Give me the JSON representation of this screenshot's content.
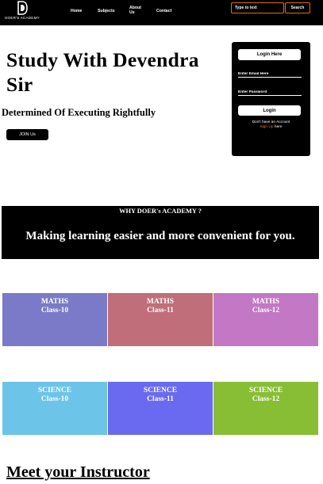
{
  "brand": {
    "logo_text": "DOER'S ACADEMY",
    "accent_color": "#e86a14"
  },
  "nav": {
    "items": [
      {
        "label": "Home"
      },
      {
        "label": "Subjects"
      },
      {
        "label": "About Us"
      },
      {
        "label": "Contact"
      }
    ],
    "search": {
      "placeholder": "Type to text",
      "button_label": "Search"
    }
  },
  "hero": {
    "title": "Study With Devendra Sir",
    "subtitle": "Determined Of Executing Rightfully",
    "cta_label": "JOIN Us"
  },
  "login": {
    "heading": "Login Here",
    "email_placeholder": "Enter Email Here",
    "password_placeholder": "Enter Password",
    "submit_label": "Login",
    "no_account_text": "Don't have an Account",
    "signup_label": "Sign Up",
    "signup_suffix": "here"
  },
  "why": {
    "label": "WHY DOER's ACADEMY ?",
    "text": "Making learning easier and more convenient for you."
  },
  "courses": [
    {
      "subject": "MATHS",
      "level": "Class-10",
      "color": "#7a7ac8"
    },
    {
      "subject": "MATHS",
      "level": "Class-11",
      "color": "#bf6e7a"
    },
    {
      "subject": "MATHS",
      "level": "Class-12",
      "color": "#c278c4"
    },
    {
      "subject": "SCIENCE",
      "level": "Class-10",
      "color": "#6cc4e8"
    },
    {
      "subject": "SCIENCE",
      "level": "Class-11",
      "color": "#6a6af0"
    },
    {
      "subject": "SCIENCE",
      "level": "Class-12",
      "color": "#88be34"
    }
  ],
  "instructor": {
    "heading": "Meet your Instructor"
  }
}
